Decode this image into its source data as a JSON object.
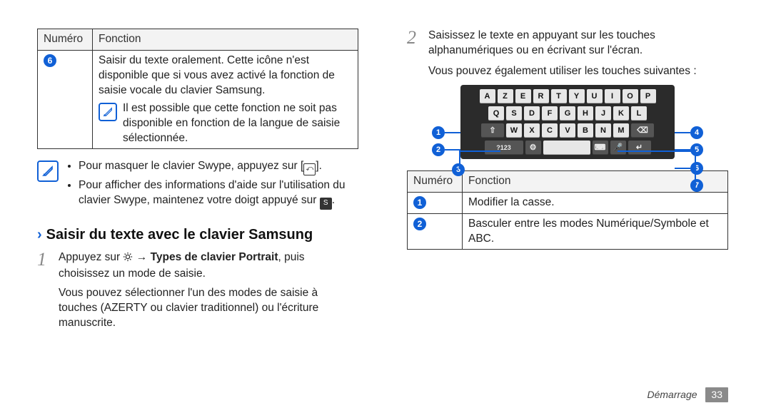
{
  "left": {
    "table": {
      "header_num": "Numéro",
      "header_func": "Fonction",
      "row_num": "6",
      "row_func_main": "Saisir du texte oralement. Cette icône n'est disponible que si vous avez activé la fonction de saisie vocale du clavier Samsung.",
      "row_note": "Il est possible que cette fonction ne soit pas disponible en fonction de la langue de saisie sélectionnée."
    },
    "tips": {
      "bullet1_a": "Pour masquer le clavier Swype, appuyez sur [",
      "bullet1_b": "].",
      "bullet2_a": "Pour afficher des informations d'aide sur l'utilisation du clavier Swype, maintenez votre doigt appuyé sur ",
      "bullet2_b": "."
    },
    "section_title": "Saisir du texte avec le clavier Samsung",
    "step1_a": "Appuyez sur ",
    "step1_b": " → ",
    "step1_bold": "Types de clavier Portrait",
    "step1_c": ", puis choisissez un mode de saisie.",
    "step1_sub": "Vous pouvez sélectionner l'un des modes de saisie à touches (AZERTY ou clavier traditionnel) ou l'écriture manuscrite."
  },
  "right": {
    "step2": "Saisissez le texte en appuyant sur les touches alphanumériques ou en écrivant sur l'écran.",
    "followup": "Vous pouvez également utiliser les touches suivantes :",
    "markers": [
      "1",
      "2",
      "3",
      "4",
      "5",
      "6",
      "7"
    ],
    "table": {
      "header_num": "Numéro",
      "header_func": "Fonction",
      "r1_num": "1",
      "r1_func": "Modifier la casse.",
      "r2_num": "2",
      "r2_func": "Basculer entre les modes Numérique/Symbole et ABC."
    },
    "footer_label": "Démarrage",
    "footer_page": "33"
  },
  "keyboard": {
    "row1": [
      "A",
      "Z",
      "E",
      "R",
      "T",
      "Y",
      "U",
      "I",
      "O",
      "P"
    ],
    "row2": [
      "Q",
      "S",
      "D",
      "F",
      "G",
      "H",
      "J",
      "K",
      "L"
    ],
    "row3_shift": "⇧",
    "row3": [
      "W",
      "X",
      "C",
      "V",
      "B",
      "N",
      "M"
    ],
    "row3_back": "⌫",
    "row4_sym": "?123",
    "row4_gear": "⚙",
    "row4_lang": "⌨",
    "row4_mic": "🎤",
    "row4_enter": "↵"
  }
}
